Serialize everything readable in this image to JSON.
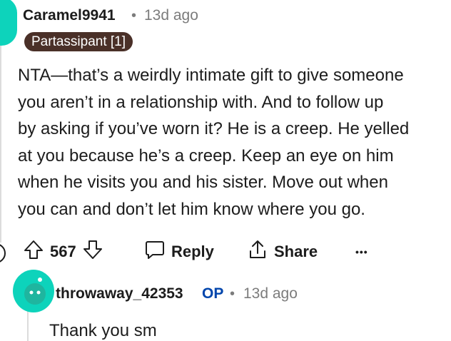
{
  "comment": {
    "username": "Caramel9941",
    "separator": "•",
    "timestamp": "13d ago",
    "flair": "Partassipant [1]",
    "body_lines": [
      "NTA—that’s a weirdly intimate gift to give someone",
      "you aren’t in a relationship with. And to follow up",
      "by asking if you’ve worn it? He is a creep. He yelled",
      "at you because he’s a creep. Keep an eye on him",
      "when he visits you and his sister. Move out when",
      "you can and don’t let him know where you go."
    ],
    "actions": {
      "vote_count": "567",
      "reply_label": "Reply",
      "share_label": "Share",
      "more_label": "•••"
    },
    "avatar_color": "#0dd3bb"
  },
  "reply": {
    "username": "throwaway_42353",
    "op_badge": "OP",
    "separator": "•",
    "timestamp": "13d ago",
    "body": "Thank you sm",
    "avatar_color": "#0dd3bb",
    "op_color": "#0045ac"
  },
  "flair_color": "#4a3028",
  "icons": [
    "upvote-icon",
    "downvote-icon",
    "comment-icon",
    "share-icon",
    "more-icon"
  ]
}
